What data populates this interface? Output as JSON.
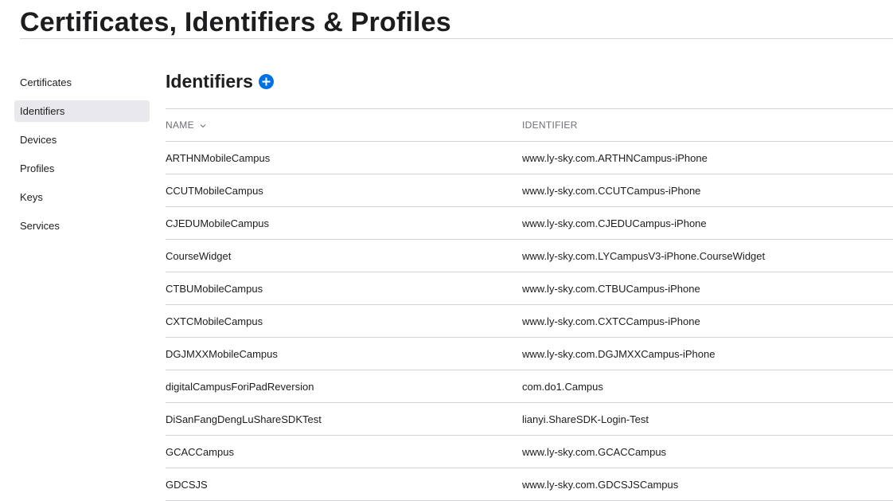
{
  "header": {
    "title": "Certificates, Identifiers & Profiles"
  },
  "sidebar": {
    "items": [
      {
        "label": "Certificates",
        "active": false
      },
      {
        "label": "Identifiers",
        "active": true
      },
      {
        "label": "Devices",
        "active": false
      },
      {
        "label": "Profiles",
        "active": false
      },
      {
        "label": "Keys",
        "active": false
      },
      {
        "label": "Services",
        "active": false
      }
    ]
  },
  "main": {
    "section_title": "Identifiers",
    "add_icon": "plus-circle-icon",
    "table": {
      "columns": {
        "name": "NAME",
        "identifier": "IDENTIFIER",
        "sort_icon": "chevron-down-icon"
      },
      "rows": [
        {
          "name": "ARTHNMobileCampus",
          "identifier": "www.ly-sky.com.ARTHNCampus-iPhone"
        },
        {
          "name": "CCUTMobileCampus",
          "identifier": "www.ly-sky.com.CCUTCampus-iPhone"
        },
        {
          "name": "CJEDUMobileCampus",
          "identifier": "www.ly-sky.com.CJEDUCampus-iPhone"
        },
        {
          "name": "CourseWidget",
          "identifier": "www.ly-sky.com.LYCampusV3-iPhone.CourseWidget"
        },
        {
          "name": "CTBUMobileCampus",
          "identifier": "www.ly-sky.com.CTBUCampus-iPhone"
        },
        {
          "name": "CXTCMobileCampus",
          "identifier": "www.ly-sky.com.CXTCCampus-iPhone"
        },
        {
          "name": "DGJMXXMobileCampus",
          "identifier": "www.ly-sky.com.DGJMXXCampus-iPhone"
        },
        {
          "name": "digitalCampusForiPadReversion",
          "identifier": "com.do1.Campus"
        },
        {
          "name": "DiSanFangDengLuShareSDKTest",
          "identifier": "lianyi.ShareSDK-Login-Test"
        },
        {
          "name": "GCACCampus",
          "identifier": "www.ly-sky.com.GCACCampus"
        },
        {
          "name": "GDCSJS",
          "identifier": "www.ly-sky.com.GDCSJSCampus"
        }
      ]
    }
  },
  "colors": {
    "accent": "#0071e3",
    "active_bg": "#e8e8ed",
    "divider": "#d2d2d7",
    "text": "#1d1d1f",
    "muted_text": "#6e6e73"
  }
}
